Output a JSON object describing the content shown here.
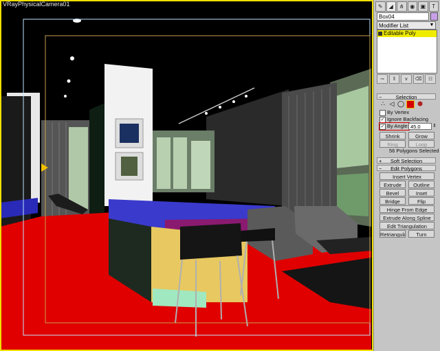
{
  "viewport": {
    "label": "VRayPhysicalCamera01"
  },
  "panel": {
    "tabs": [
      "create-tab",
      "modify-tab",
      "hierarchy-tab",
      "motion-tab",
      "display-tab",
      "utilities-tab"
    ],
    "object_name": "Box04",
    "object_color": "#c8a0e8",
    "modifier_list": "Modifier List",
    "stack_item": "Editable Poly",
    "selection": {
      "header": "Selection",
      "by_vertex": "By Vertex",
      "ignore_backfacing": "Ignore Backfacing",
      "by_angle": "By Angle:",
      "angle_value": "45.0",
      "shrink": "Shrink",
      "grow": "Grow",
      "ring": "Ring",
      "loop": "Loop",
      "status": "56 Polygons Selected"
    },
    "soft_selection": {
      "header": "Soft Selection"
    },
    "edit_polygons": {
      "header": "Edit Polygons",
      "insert_vertex": "Insert Vertex",
      "extrude": "Extrude",
      "outline": "Outline",
      "bevel": "Bevel",
      "inset": "Inset",
      "bridge": "Bridge",
      "flip": "Flip",
      "hinge": "Hinge From Edge",
      "extrude_spline": "Extrude Along Spline",
      "edit_tri": "Edit Triangulation",
      "retriangulate": "Retriangulate",
      "turn": "Turn"
    },
    "colors": {
      "stack_highlight": "#f0ec00",
      "viewport_border": "#f0e000",
      "accent_red": "#d40000"
    }
  }
}
